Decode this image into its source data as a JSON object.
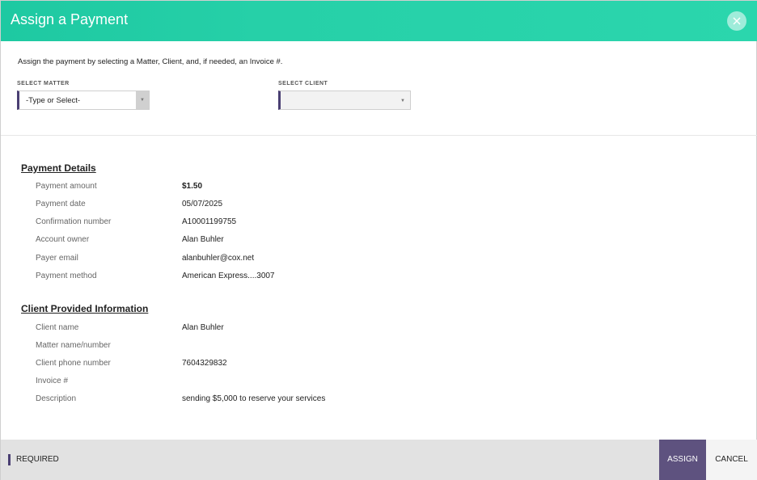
{
  "header": {
    "title": "Assign a Payment",
    "close_icon": "close-icon"
  },
  "intro": {
    "text": "Assign the payment by selecting a Matter, Client, and, if needed, an Invoice #."
  },
  "matter_select": {
    "label": "SELECT MATTER",
    "value": "-Type or Select-"
  },
  "client_select": {
    "label": "SELECT CLIENT",
    "value": ""
  },
  "payment_details": {
    "title": "Payment Details",
    "rows": [
      {
        "label": "Payment amount",
        "value": "$1.50"
      },
      {
        "label": "Payment date",
        "value": "05/07/2025"
      },
      {
        "label": "Confirmation number",
        "value": "A10001199755"
      },
      {
        "label": "Account owner",
        "value": "Alan Buhler"
      },
      {
        "label": "Payer email",
        "value": "alanbuhler@cox.net"
      },
      {
        "label": "Payment method",
        "value": "American Express....3007"
      }
    ]
  },
  "client_info": {
    "title": "Client Provided Information",
    "rows": [
      {
        "label": "Client name",
        "value": "Alan Buhler"
      },
      {
        "label": "Matter name/number",
        "value": ""
      },
      {
        "label": "Client phone number",
        "value": "7604329832"
      },
      {
        "label": "Invoice #",
        "value": ""
      },
      {
        "label": "Description",
        "value": "sending $5,000 to reserve your services"
      }
    ]
  },
  "footer": {
    "required_label": "REQUIRED",
    "assign_label": "ASSIGN",
    "cancel_label": "CANCEL"
  },
  "colors": {
    "header_accent": "#26d0a8",
    "required_marker": "#4a3f73",
    "assign_button": "#5e527f"
  }
}
